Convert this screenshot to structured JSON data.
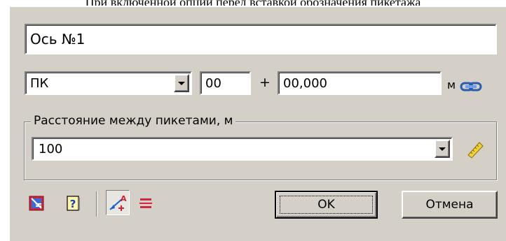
{
  "caption": "При включенной опции перед вставкой обозначения пикетажа",
  "name_field": {
    "value": "Ось №1"
  },
  "station": {
    "prefix_value": "ПК",
    "pk_value": "00",
    "plus": "+",
    "offset_value": "00,000",
    "unit": "м"
  },
  "group": {
    "title": "Расстояние между пикетами, м",
    "distance_value": "100"
  },
  "buttons": {
    "ok": "OK",
    "cancel": "Отмена"
  },
  "icons": {
    "link": "link-icon",
    "ruler": "ruler-icon",
    "style": "style-icon",
    "help": "help-icon",
    "insert_before": "station-label-insert-icon",
    "align": "align-lines-icon"
  }
}
